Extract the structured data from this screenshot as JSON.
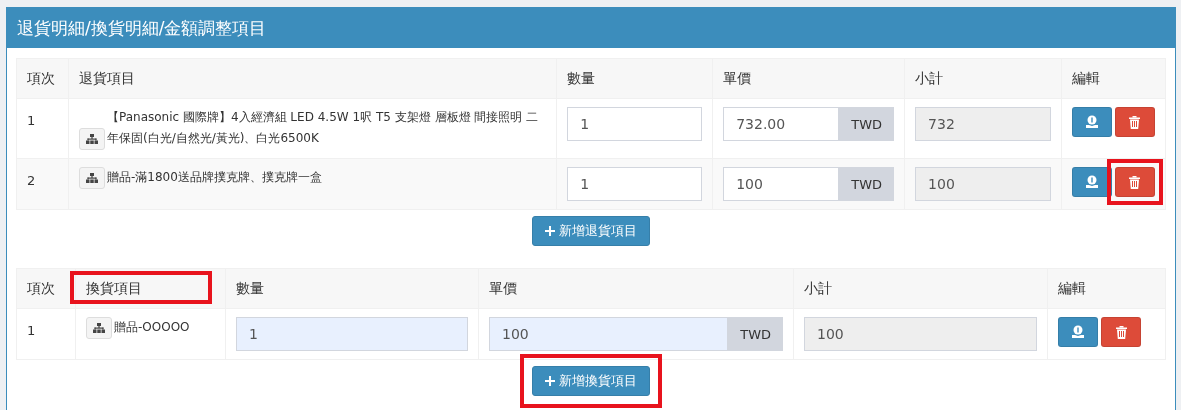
{
  "panel": {
    "title": "退貨明細/換貨明細/金額調整項目"
  },
  "return_table": {
    "columns": [
      {
        "label": "項次",
        "highlighted": false
      },
      {
        "label": "退貨項目",
        "highlighted": false
      },
      {
        "label": "數量",
        "highlighted": false
      },
      {
        "label": "單價",
        "highlighted": false
      },
      {
        "label": "小計",
        "highlighted": false
      },
      {
        "label": "編輯",
        "highlighted": false
      }
    ],
    "rows": [
      {
        "index": "1",
        "name": "【Panasonic 國際牌】4入經濟組 LED 4.5W 1呎 T5 支架燈 層板燈 間接照明 二年保固(白光/自然光/黃光)、白光6500K",
        "quantity": "1",
        "price": "732.00",
        "currency": "TWD",
        "subtotal": "732",
        "autofilled": false,
        "delete_highlighted": false
      },
      {
        "index": "2",
        "name": "贈品-滿1800送品牌撲克牌、撲克牌一盒",
        "quantity": "1",
        "price": "100",
        "currency": "TWD",
        "subtotal": "100",
        "autofilled": false,
        "delete_highlighted": true
      }
    ],
    "add_button": {
      "label": "新增退貨項目",
      "highlighted": false
    }
  },
  "exchange_table": {
    "columns": [
      {
        "label": "項次",
        "highlighted": false
      },
      {
        "label": "換貨項目",
        "highlighted": true
      },
      {
        "label": "數量",
        "highlighted": false
      },
      {
        "label": "單價",
        "highlighted": false
      },
      {
        "label": "小計",
        "highlighted": false
      },
      {
        "label": "編輯",
        "highlighted": false
      }
    ],
    "rows": [
      {
        "index": "1",
        "name": "贈品-OOOOO",
        "quantity": "1",
        "price": "100",
        "currency": "TWD",
        "subtotal": "100",
        "autofilled": true,
        "delete_highlighted": false
      }
    ],
    "add_button": {
      "label": "新增換貨項目",
      "highlighted": true
    }
  }
}
